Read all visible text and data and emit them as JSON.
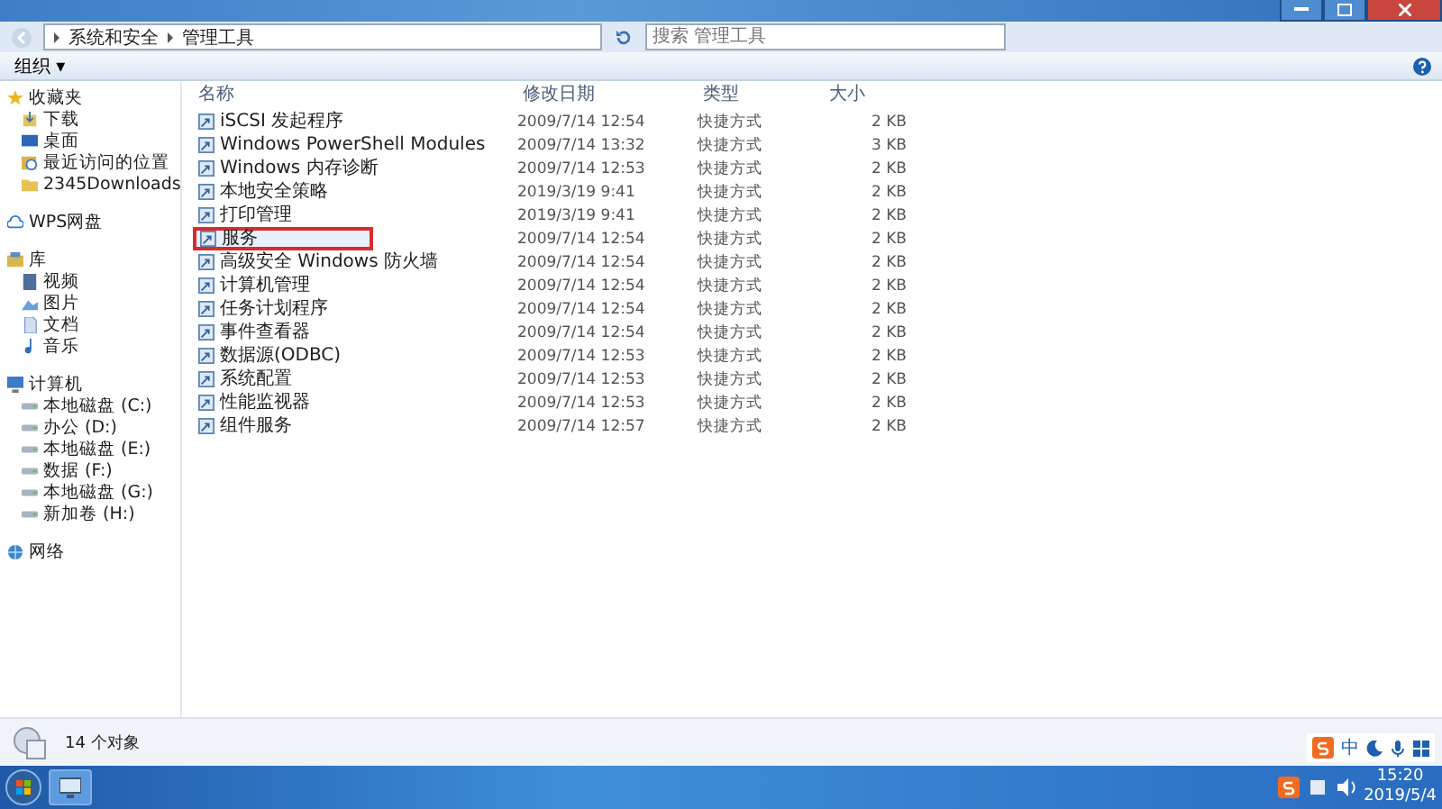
{
  "address_bar": {
    "crumbs": [
      "系统和安全",
      "管理工具"
    ],
    "search_placeholder": "搜索 管理工具"
  },
  "toolbar": {
    "organize": "组织 ▾"
  },
  "sidebar": {
    "items": [
      {
        "label": "收藏夹",
        "kind": "star",
        "children": [
          {
            "label": "下载",
            "kind": "download"
          },
          {
            "label": "桌面",
            "kind": "desktop"
          },
          {
            "label": "最近访问的位置",
            "kind": "recent"
          },
          {
            "label": "2345Downloads",
            "kind": "folder"
          }
        ]
      },
      {
        "label": "WPS网盘",
        "kind": "cloud"
      },
      {
        "label": "库",
        "kind": "library",
        "children": [
          {
            "label": "视频",
            "kind": "video"
          },
          {
            "label": "图片",
            "kind": "picture"
          },
          {
            "label": "文档",
            "kind": "doc"
          },
          {
            "label": "音乐",
            "kind": "music"
          }
        ]
      },
      {
        "label": "计算机",
        "kind": "computer",
        "children": [
          {
            "label": "本地磁盘 (C:)",
            "kind": "drive"
          },
          {
            "label": "办公 (D:)",
            "kind": "drive"
          },
          {
            "label": "本地磁盘 (E:)",
            "kind": "drive"
          },
          {
            "label": "数据 (F:)",
            "kind": "drive"
          },
          {
            "label": "本地磁盘 (G:)",
            "kind": "drive"
          },
          {
            "label": "新加卷 (H:)",
            "kind": "drive"
          }
        ]
      },
      {
        "label": "网络",
        "kind": "network"
      }
    ]
  },
  "table": {
    "columns": [
      "名称",
      "修改日期",
      "类型",
      "大小"
    ],
    "rows": [
      {
        "cells": [
          "iSCSI 发起程序",
          "2009/7/14 12:54",
          "快捷方式",
          "2 KB"
        ],
        "annotated": false
      },
      {
        "cells": [
          "Windows PowerShell Modules",
          "2009/7/14 13:32",
          "快捷方式",
          "3 KB"
        ],
        "annotated": false
      },
      {
        "cells": [
          "Windows 内存诊断",
          "2009/7/14 12:53",
          "快捷方式",
          "2 KB"
        ],
        "annotated": false
      },
      {
        "cells": [
          "本地安全策略",
          "2019/3/19 9:41",
          "快捷方式",
          "2 KB"
        ],
        "annotated": false
      },
      {
        "cells": [
          "打印管理",
          "2019/3/19 9:41",
          "快捷方式",
          "2 KB"
        ],
        "annotated": false
      },
      {
        "cells": [
          "服务",
          "2009/7/14 12:54",
          "快捷方式",
          "2 KB"
        ],
        "annotated": true
      },
      {
        "cells": [
          "高级安全 Windows 防火墙",
          "2009/7/14 12:54",
          "快捷方式",
          "2 KB"
        ],
        "annotated": false
      },
      {
        "cells": [
          "计算机管理",
          "2009/7/14 12:54",
          "快捷方式",
          "2 KB"
        ],
        "annotated": false
      },
      {
        "cells": [
          "任务计划程序",
          "2009/7/14 12:54",
          "快捷方式",
          "2 KB"
        ],
        "annotated": false
      },
      {
        "cells": [
          "事件查看器",
          "2009/7/14 12:54",
          "快捷方式",
          "2 KB"
        ],
        "annotated": false
      },
      {
        "cells": [
          "数据源(ODBC)",
          "2009/7/14 12:53",
          "快捷方式",
          "2 KB"
        ],
        "annotated": false
      },
      {
        "cells": [
          "系统配置",
          "2009/7/14 12:53",
          "快捷方式",
          "2 KB"
        ],
        "annotated": false
      },
      {
        "cells": [
          "性能监视器",
          "2009/7/14 12:53",
          "快捷方式",
          "2 KB"
        ],
        "annotated": false
      },
      {
        "cells": [
          "组件服务",
          "2009/7/14 12:57",
          "快捷方式",
          "2 KB"
        ],
        "annotated": false
      }
    ]
  },
  "status_bar": {
    "count": "14 个对象"
  },
  "ime_bar": {
    "mode": "中"
  },
  "taskbar": {
    "time": "15:20",
    "date": "2019/5/4"
  }
}
